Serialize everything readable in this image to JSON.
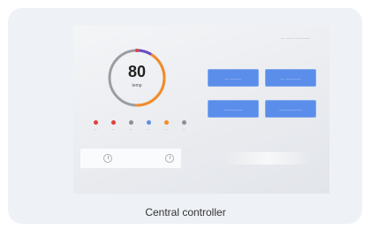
{
  "caption": "Central controller",
  "screen": {
    "header_text": "— —— ————",
    "gauge": {
      "value": "80",
      "unit": "temp",
      "level_fraction": 0.8,
      "colors": {
        "orange": "#f28c28",
        "purple": "#6a4bc4",
        "red": "#e0413a",
        "track": "#9a9da3"
      }
    },
    "status_items": [
      {
        "color": "#e0413a",
        "label": "—"
      },
      {
        "color": "#e0413a",
        "label": "—"
      },
      {
        "color": "#8a8f99",
        "label": "—"
      },
      {
        "color": "#5b8eea",
        "label": "—"
      },
      {
        "color": "#f28c28",
        "label": "—"
      },
      {
        "color": "#8a8f99",
        "label": "—"
      }
    ],
    "buttons": [
      {
        "label": "— ———"
      },
      {
        "label": "— ————"
      },
      {
        "label": "—————"
      },
      {
        "label": "——————"
      }
    ],
    "bottom_icons": [
      "clock-icon",
      "timer-icon"
    ]
  },
  "colors": {
    "card_bg": "#eef1f5",
    "button_blue": "#5b8eea"
  }
}
